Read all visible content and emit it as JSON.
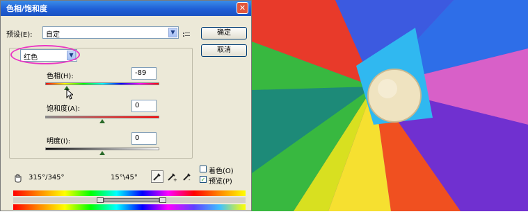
{
  "dialog": {
    "title": "色相/饱和度",
    "close_label": "✕",
    "preset_label": "预设(E):",
    "preset_value": "自定",
    "ok_label": "确定",
    "cancel_label": "取消",
    "channel_value": "红色",
    "hue_label": "色相(H):",
    "hue_value": "-89",
    "saturation_label": "饱和度(A):",
    "saturation_value": "0",
    "lightness_label": "明度(I):",
    "lightness_value": "0",
    "range_left": "315°/345°",
    "range_right": "15°\\45°",
    "colorize_label": "着色(O)",
    "preview_label": "预览(P)",
    "preview_checked": "✓"
  },
  "colors": {
    "title_bar": "#1f5fd6",
    "dialog_bg": "#ece9d8",
    "highlight": "#ea35c4"
  },
  "icons": {
    "close": "close-icon",
    "dropdown": "chevron-down-icon",
    "menu": "menu-icon",
    "hand": "hand-icon",
    "eyedropper": "eyedropper-icon",
    "eyedropper_plus": "eyedropper-plus-icon",
    "eyedropper_minus": "eyedropper-minus-icon"
  }
}
